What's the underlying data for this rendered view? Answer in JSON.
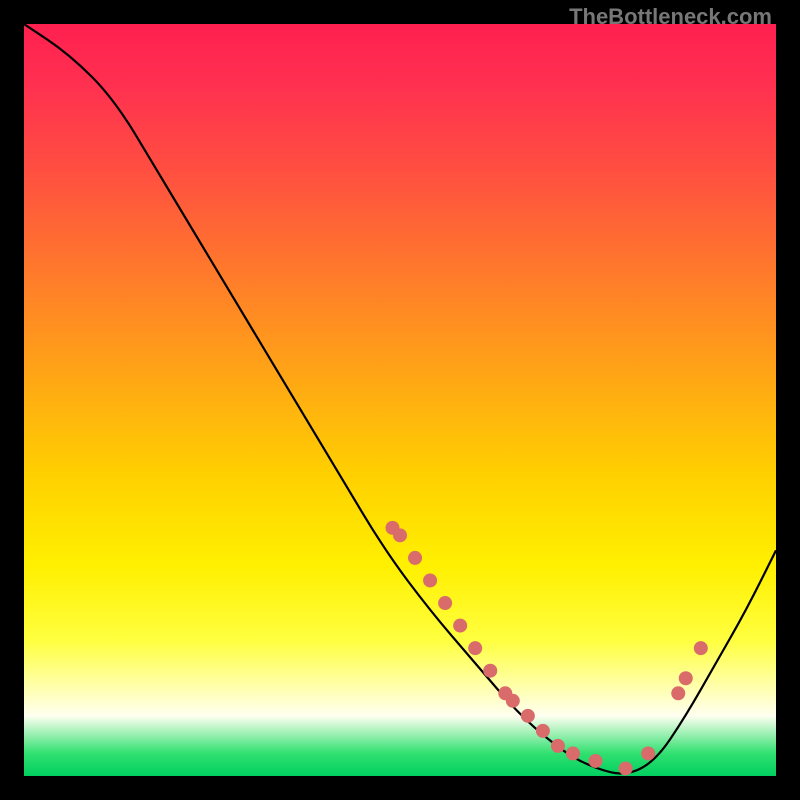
{
  "attribution": "TheBottleneck.com",
  "chart_data": {
    "type": "line",
    "title": "",
    "xlabel": "",
    "ylabel": "",
    "xlim": [
      0,
      100
    ],
    "ylim": [
      0,
      100
    ],
    "series": [
      {
        "name": "bottleneck-curve",
        "x": [
          0,
          6,
          12,
          18,
          24,
          30,
          36,
          42,
          48,
          54,
          60,
          66,
          72,
          76,
          80,
          84,
          88,
          92,
          96,
          100
        ],
        "y": [
          100,
          96,
          90,
          80,
          70,
          60,
          50,
          40,
          30,
          22,
          15,
          8,
          3,
          1,
          0,
          2,
          8,
          15,
          22,
          30
        ]
      }
    ],
    "highlight_points": {
      "name": "data-markers",
      "color": "#d96b6b",
      "x": [
        49,
        50,
        52,
        54,
        56,
        58,
        60,
        62,
        64,
        65,
        67,
        69,
        71,
        73,
        76,
        80,
        83,
        87,
        88,
        90
      ],
      "y": [
        33,
        32,
        29,
        26,
        23,
        20,
        17,
        14,
        11,
        10,
        8,
        6,
        4,
        3,
        2,
        1,
        3,
        11,
        13,
        17
      ]
    }
  }
}
